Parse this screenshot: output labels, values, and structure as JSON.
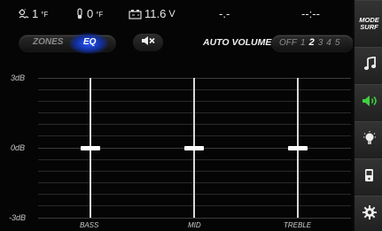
{
  "status_bar": {
    "outside_temp": "1",
    "outside_temp_unit": "°F",
    "water_temp": "0",
    "water_temp_unit": "°F",
    "battery": "11.6",
    "battery_unit": "V",
    "field_4": "-.-",
    "field_5": "--:--"
  },
  "controls": {
    "zones_label": "ZONES",
    "eq_label": "EQ",
    "mute_icon": "speaker-mute-icon",
    "auto_volume_label": "AUTO VOLUME",
    "auto_volume_off": "OFF",
    "auto_volume_levels": [
      "1",
      "2",
      "3",
      "4",
      "5"
    ],
    "auto_volume_selected": "2"
  },
  "eq": {
    "db_labels": {
      "top": "3dB",
      "mid": "0dB",
      "bottom": "-3dB"
    },
    "bands": [
      {
        "label": "BASS",
        "value_db": 0
      },
      {
        "label": "MID",
        "value_db": 0
      },
      {
        "label": "TREBLE",
        "value_db": 0
      }
    ]
  },
  "sidebar": {
    "mode_line1": "MODE",
    "mode_line2": "SURF",
    "icons": [
      "music-note-icon",
      "volume-icon",
      "light-bulb-icon",
      "phone-icon",
      "settings-gear-icon"
    ],
    "active_color": "#3fcf3f"
  }
}
